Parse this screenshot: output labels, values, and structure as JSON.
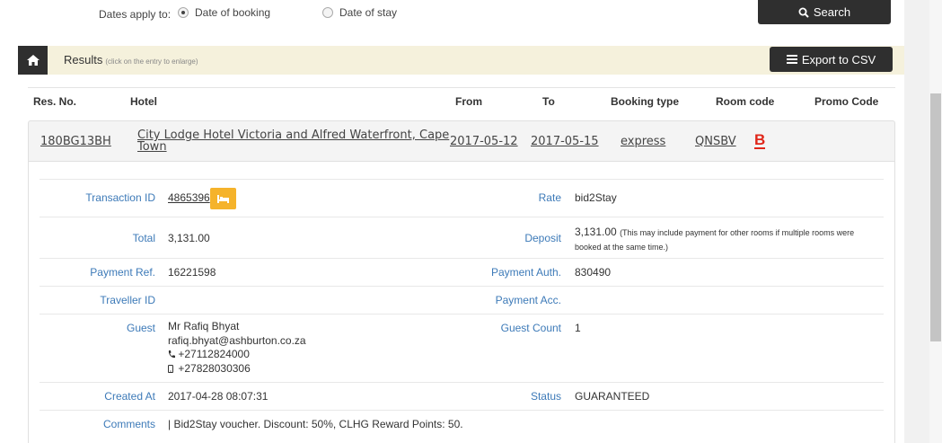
{
  "filter": {
    "label": "Dates apply to:",
    "options": [
      {
        "label": "Date of booking",
        "selected": true
      },
      {
        "label": "Date of stay",
        "selected": false
      }
    ],
    "search_label": "Search"
  },
  "results": {
    "title": "Results",
    "hint": "(click on the entry to enlarge)",
    "export_label": "Export to CSV"
  },
  "columns": [
    "Res. No.",
    "Hotel",
    "From",
    "To",
    "Booking type",
    "Room code",
    "Promo Code"
  ],
  "booking": {
    "res_no": "180BG13BH",
    "hotel_line1": "City Lodge Hotel Victoria and Alfred Waterfront, Cape",
    "hotel_line2": "Town",
    "from": "2017-05-12",
    "to": "2017-05-15",
    "booking_type": "express",
    "room_code": "QNSBV",
    "promo_badge": "B"
  },
  "details": {
    "transaction_id_label": "Transaction ID",
    "transaction_id": "4865396",
    "rate_label": "Rate",
    "rate": "bid2Stay",
    "total_label": "Total",
    "total": "3,131.00",
    "deposit_label": "Deposit",
    "deposit": "3,131.00",
    "deposit_note_1": "(This may include payment for other rooms if multiple rooms were",
    "deposit_note_2": "booked at the same time.)",
    "payment_ref_label": "Payment Ref.",
    "payment_ref": "16221598",
    "payment_auth_label": "Payment Auth.",
    "payment_auth": "830490",
    "traveller_id_label": "Traveller ID",
    "payment_acc_label": "Payment Acc.",
    "guest_label": "Guest",
    "guest_name": "Mr Rafiq Bhyat",
    "guest_email": "rafiq.bhyat@ashburton.co.za",
    "guest_phone": "+27112824000",
    "guest_mobile": "+27828030306",
    "guest_count_label": "Guest Count",
    "guest_count": "1",
    "created_at_label": "Created At",
    "created_at": "2017-04-28 08:07:31",
    "status_label": "Status",
    "status": "GUARANTEED",
    "comments_label": "Comments",
    "comments": "| Bid2Stay voucher. Discount: 50%, CLHG Reward Points: 50."
  },
  "colors": {
    "dark_button": "#2f2f2f",
    "label_blue": "#3d7ab8",
    "promo_red": "#e0261a",
    "badge_yellow": "#f5b32b",
    "results_bar": "#f5f1dc"
  }
}
